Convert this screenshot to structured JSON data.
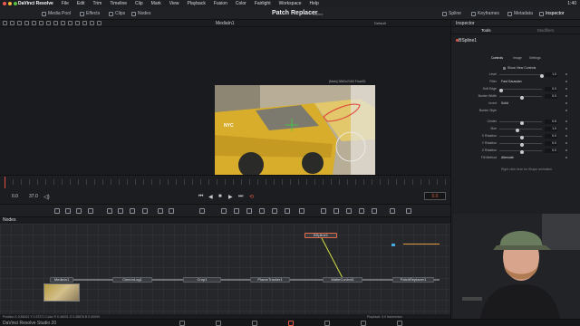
{
  "menubar": {
    "app": "DaVinci Resolve",
    "items": [
      "File",
      "Edit",
      "Trim",
      "Timeline",
      "Clip",
      "Mark",
      "View",
      "Playback",
      "Fusion",
      "Color",
      "Fairlight",
      "Workspace",
      "Help"
    ],
    "clock": "1:40"
  },
  "toolbar": {
    "media_pool": "Media Pool",
    "effects": "Effects",
    "clips": "Clips",
    "nodes": "Nodes",
    "title": "Patch Replacer",
    "edited": "Edited",
    "spline": "Spline",
    "keyframes": "Keyframes",
    "metadata": "Metadata",
    "inspector": "Inspector"
  },
  "viewer": {
    "name": "MediaIn1",
    "preset": "Default",
    "resolution": "[Main] 3840x2160 Float32"
  },
  "transport": {
    "start": "0.0",
    "end": "37.0",
    "current": "0.0"
  },
  "nodes": {
    "header": "Nodes",
    "items": [
      {
        "label": "MediaIn1"
      },
      {
        "label": "CineonLog1"
      },
      {
        "label": "Crop1"
      },
      {
        "label": "PlanarTracker1"
      },
      {
        "label": "MatteControl1"
      },
      {
        "label": "PatchReplacer1"
      },
      {
        "label": "BSpline1"
      }
    ]
  },
  "status": {
    "left": "Position X 0.85021  Y 0.37271  Color R 0.46001  G 0.48876  B 0.40099",
    "right": "Playback: 3.0 frames/sec"
  },
  "pagebar": {
    "brand": "DaVinci Resolve Studio 20"
  },
  "inspector": {
    "title": "Inspector",
    "tools_tab": "Tools",
    "modifiers_tab": "Modifiers",
    "node_name": "BSpline1",
    "control_tabs": [
      "Controls",
      "Image",
      "Settings"
    ],
    "show_view_controls": "Show View Controls",
    "params": [
      {
        "label": "Level",
        "value": "1.0",
        "fill": 1.0
      },
      {
        "label": "Filter",
        "value": "Fast Gaussian",
        "fill": null
      },
      {
        "label": "Soft Edge",
        "value": "0.0",
        "fill": 0.0
      },
      {
        "label": "Border Width",
        "value": "0.0",
        "fill": 0.5
      },
      {
        "label": "Invert",
        "value": "Solid",
        "fill": null
      },
      {
        "label": "Border Style",
        "value": "",
        "fill": null
      },
      {
        "label": "Center",
        "value": "0.5",
        "fill": 0.5
      },
      {
        "label": "Size",
        "value": "1.0",
        "fill": 0.4
      },
      {
        "label": "X Rotation",
        "value": "0.0",
        "fill": 0.5
      },
      {
        "label": "Y Rotation",
        "value": "0.0",
        "fill": 0.5
      },
      {
        "label": "Z Rotation",
        "value": "0.0",
        "fill": 0.5
      },
      {
        "label": "Fill Method",
        "value": "Alternate",
        "fill": null
      }
    ],
    "hint": "Right click here for Shape animation"
  },
  "colors": {
    "accent": "#e05a4a",
    "panel": "#1e1f22",
    "wire": "#b7b9be",
    "mask_wire": "#d0e040"
  }
}
